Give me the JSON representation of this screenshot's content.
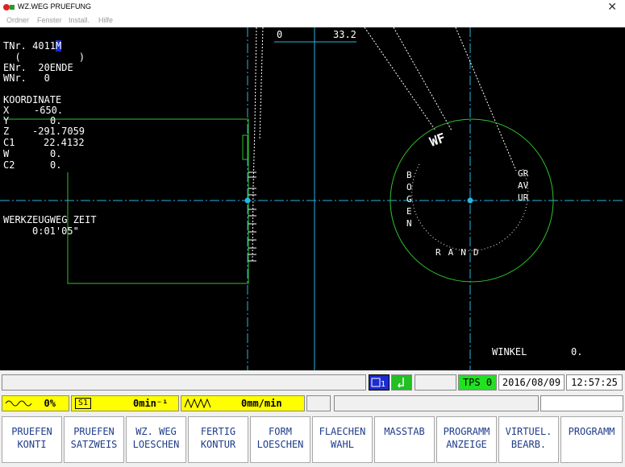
{
  "window": {
    "title": "WZ.WEG PRUEFUNG",
    "close_glyph": "✕"
  },
  "menu": [
    "Ordner",
    "Fenster",
    "Install.",
    "Hilfe"
  ],
  "info": {
    "tnr_label": "TNr.",
    "tnr_value": "4011",
    "tnr_suffix": "M",
    "paren_line": "  (          )",
    "enr_label": "ENr.",
    "enr_value": "20ENDE",
    "wnr_label": "WNr.",
    "wnr_value": "0"
  },
  "koordinate": {
    "title": "KOORDINATE",
    "rows": [
      {
        "axis": "X",
        "value": "-650."
      },
      {
        "axis": "Y",
        "value": "0."
      },
      {
        "axis": "Z",
        "value": "-291.7059"
      },
      {
        "axis": "C1",
        "value": "22.4132"
      },
      {
        "axis": "W",
        "value": "0."
      },
      {
        "axis": "C2",
        "value": "0."
      }
    ]
  },
  "zeit": {
    "label": "WERKZEUGWEG ZEIT",
    "value": "0:01'05\""
  },
  "scale": {
    "left": "0",
    "right": "33.2"
  },
  "engraving": {
    "logo": "WF",
    "left_text": "BOGEN",
    "right_text": "GRAVUR",
    "bottom_text": "RAND"
  },
  "winkel": {
    "label": "WINKEL",
    "value": "0."
  },
  "status": {
    "tps": "TPS 0",
    "date": "2016/08/09",
    "time": "12:57:25",
    "icon1": "channel-1-icon",
    "icon2": "confirm-icon"
  },
  "speeds": {
    "override": "0%",
    "spindle_label": "S1",
    "spindle": "0min⁻¹",
    "feed": "0mm/min"
  },
  "softkeys": [
    {
      "line1": "PRUEFEN",
      "line2": "KONTI"
    },
    {
      "line1": "PRUEFEN",
      "line2": "SATZWEIS"
    },
    {
      "line1": "WZ. WEG",
      "line2": "LOESCHEN"
    },
    {
      "line1": "FERTIG",
      "line2": "KONTUR"
    },
    {
      "line1": "FORM",
      "line2": "LOESCHEN"
    },
    {
      "line1": "FLAECHEN",
      "line2": "WAHL"
    },
    {
      "line1": "MASSTAB",
      "line2": ""
    },
    {
      "line1": "PROGRAMM",
      "line2": "ANZEIGE"
    },
    {
      "line1": "VIRTUEL.",
      "line2": "BEARB."
    },
    {
      "line1": "PROGRAMM",
      "line2": ""
    }
  ],
  "colors": {
    "background": "#000000",
    "axis_cyan": "#29b6e0",
    "contour_green": "#2fc22f",
    "text": "#ffffff",
    "softkey_text": "#1f3d8a",
    "highlight_yellow": "#ffff00",
    "tps_green": "#22e022"
  }
}
